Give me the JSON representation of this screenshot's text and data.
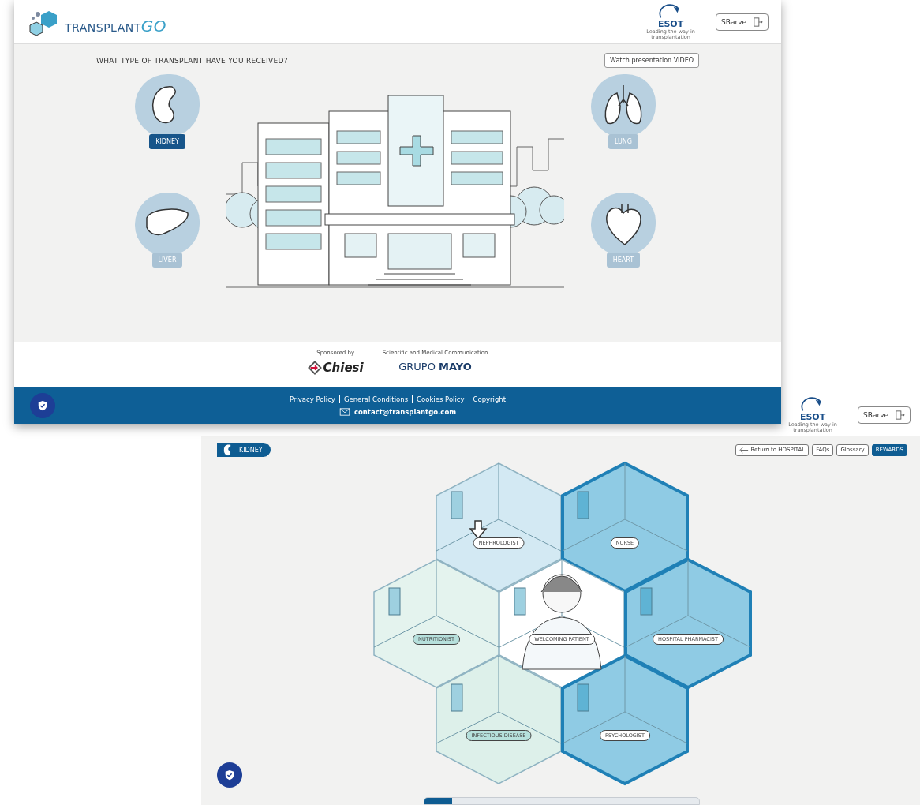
{
  "main_screen": {
    "header": {
      "logo": {
        "text": "TRANSPLANT",
        "accent": "GO"
      },
      "partner_logo": {
        "name": "ESOT",
        "tagline": "Leading the way in transplantation"
      },
      "user_button": {
        "label": "SBarve"
      }
    },
    "question": "WHAT TYPE OF TRANSPLANT HAVE YOU RECEIVED?",
    "video_button": {
      "label": "Watch presentation VIDEO"
    },
    "organs": [
      {
        "label": "KIDNEY",
        "kind": "kidney",
        "selected": true
      },
      {
        "label": "LUNG",
        "kind": "lung",
        "selected": false
      },
      {
        "label": "LIVER",
        "kind": "liver",
        "selected": false
      },
      {
        "label": "HEART",
        "kind": "heart",
        "selected": false
      }
    ],
    "sponsors": {
      "sponsored_by_label": "Sponsored by",
      "sponsor": "Chiesi",
      "communication_label": "Scientific and Medical Communication",
      "communication_partner": "GRUPO **MAYO**"
    },
    "footer": {
      "links": [
        "Privacy Policy",
        "General Conditions",
        "Cookies Policy",
        "Copyright"
      ],
      "email": "contact@transplantgo.com"
    }
  },
  "kidney_screen": {
    "header": {
      "partner_logo": {
        "name": "ESOT",
        "tagline": "Leading the way in transplantation"
      },
      "user_button": {
        "label": "SBarve"
      }
    },
    "organ_badge": {
      "label": "KIDNEY"
    },
    "nav_buttons": [
      {
        "label": "Return to HOSPITAL",
        "kind": "back",
        "selected": false
      },
      {
        "label": "FAQs",
        "kind": "plain",
        "selected": false
      },
      {
        "label": "Glossary",
        "kind": "plain",
        "selected": false
      },
      {
        "label": "REWARDS",
        "kind": "plain",
        "selected": true
      }
    ],
    "rooms": [
      {
        "label": "NEPHROLOGIST",
        "kind": "room",
        "color": "#d3e9f3",
        "outlined": false,
        "marked": true
      },
      {
        "label": "NURSE",
        "kind": "room",
        "color": "#8fcbe4",
        "outlined": true,
        "marked": false
      },
      {
        "label": "NUTRITIONIST",
        "kind": "room",
        "color": "#e4f3ee",
        "outlined": false,
        "marked": false
      },
      {
        "label": "WELCOMING PATIENT",
        "kind": "patient",
        "color": "#ffffff",
        "outlined": false,
        "marked": false
      },
      {
        "label": "HOSPITAL PHARMACIST",
        "kind": "room",
        "color": "#8fcbe4",
        "outlined": true,
        "marked": false
      },
      {
        "label": "INFECTIOUS DISEASE",
        "kind": "room",
        "color": "#ddf0ea",
        "outlined": false,
        "marked": false
      },
      {
        "label": "PSYCHOLOGIST",
        "kind": "room",
        "color": "#8fcbe4",
        "outlined": true,
        "marked": false
      }
    ],
    "progress": {
      "level": 0.1
    }
  }
}
